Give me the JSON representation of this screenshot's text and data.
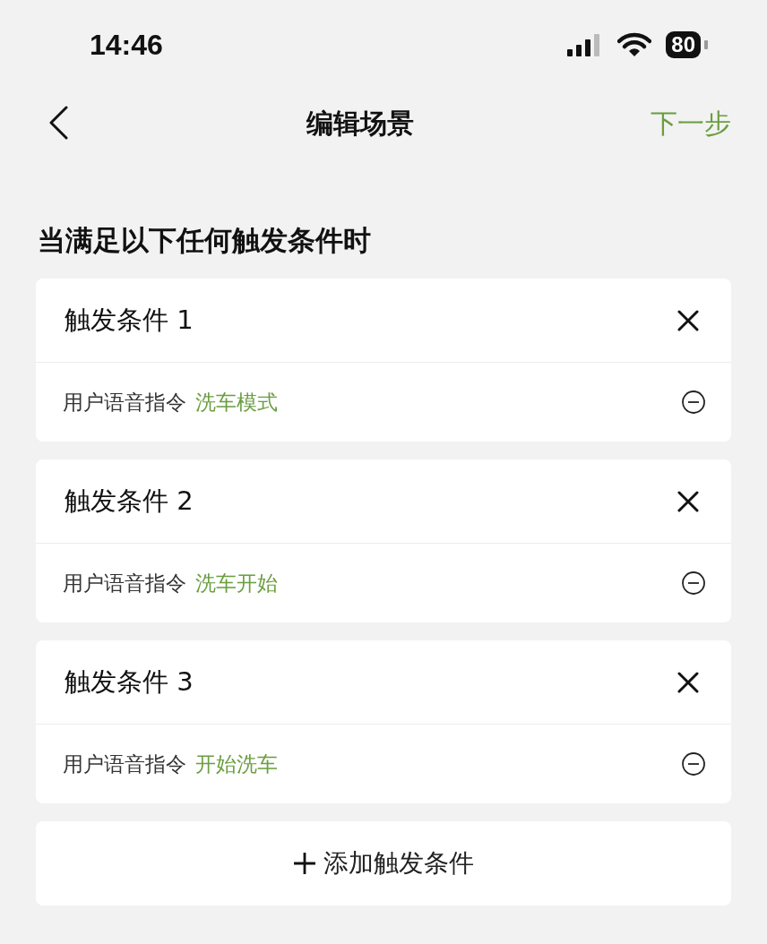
{
  "status_bar": {
    "time": "14:46",
    "battery": "80"
  },
  "nav": {
    "title": "编辑场景",
    "next": "下一步"
  },
  "heading": "当满足以下任何触发条件时",
  "conditions": [
    {
      "title": "触发条件 1",
      "label": "用户语音指令",
      "value": "洗车模式"
    },
    {
      "title": "触发条件 2",
      "label": "用户语音指令",
      "value": "洗车开始"
    },
    {
      "title": "触发条件 3",
      "label": "用户语音指令",
      "value": "开始洗车"
    }
  ],
  "add_button": {
    "label": "添加触发条件"
  }
}
